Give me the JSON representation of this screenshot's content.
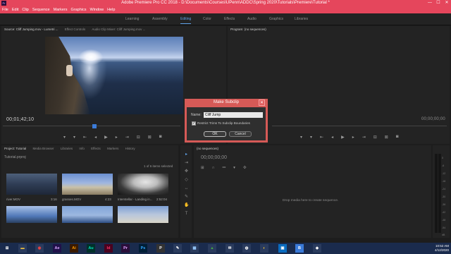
{
  "window": {
    "title": "Adobe Premiere Pro CC 2018 - D:\\Documents\\Courses\\UPenn\\ADDC\\Spring 2020\\Tutorials\\Premiere\\Tutorial *",
    "app_icon": "Pr",
    "minimize": "—",
    "maximize": "☐",
    "close": "✕"
  },
  "menu": [
    "File",
    "Edit",
    "Clip",
    "Sequence",
    "Markers",
    "Graphics",
    "Window",
    "Help"
  ],
  "workspaces": {
    "items": [
      "Learning",
      "Assembly",
      "Editing",
      "Color",
      "Effects",
      "Audio",
      "Graphics",
      "Libraries"
    ],
    "active": "Editing"
  },
  "source_panel": {
    "tabs": [
      "Source: Cliff Jumping.mov - Lumetri ...",
      "Effect Controls",
      "Audio Clip Mixer: Cliff Jumping.mov ..."
    ],
    "timecode": "00;01;42;10"
  },
  "program_panel": {
    "tabs": [
      "Program: (no sequences)"
    ],
    "timecode": "00;00;00;00"
  },
  "dialog": {
    "title": "Make Subclip",
    "close": "✕",
    "name_label": "Name:",
    "name_value": "Cliff Jump",
    "checkbox_checked": true,
    "checkbox_label": "Restrict Trims To Subclip Boundaries",
    "ok": "OK",
    "cancel": "Cancel"
  },
  "project_panel": {
    "tabs": [
      "Project: Tutorial",
      "Media Browser",
      "Libraries",
      "Info",
      "Effects",
      "Markers",
      "History"
    ],
    "path": "Tutorial.prproj",
    "item_count": "1 of 6 items selected",
    "items": [
      {
        "name": "river.MOV",
        "duration": "3:16"
      },
      {
        "name": "grasses.MOV",
        "duration": "4:23"
      },
      {
        "name": "Interstellar - Landing in...",
        "duration": "2:52:04"
      }
    ]
  },
  "timeline_panel": {
    "tabs": [
      "(no sequences)"
    ],
    "timecode": "00;00;00;00",
    "empty_message": "Drop media here to create sequence."
  },
  "meter": {
    "scale": [
      "0",
      "-6",
      "-12",
      "-18",
      "-24",
      "-30",
      "-36",
      "-42",
      "-48",
      "-54",
      "dB"
    ]
  },
  "taskbar": {
    "apps": [
      {
        "label": "⊞",
        "color": "#ffffff",
        "bg": "#1a2b4d"
      },
      {
        "label": "▬",
        "color": "#f0c040",
        "bg": "#2a3b5d"
      },
      {
        "label": "◉",
        "color": "#e44",
        "bg": "#2a3b5d"
      },
      {
        "label": "Ae",
        "color": "#d8a8ff",
        "bg": "#20114a"
      },
      {
        "label": "Ai",
        "color": "#ff9a00",
        "bg": "#3a1a00"
      },
      {
        "label": "Au",
        "color": "#00e4bb",
        "bg": "#00312a"
      },
      {
        "label": "Id",
        "color": "#ff3366",
        "bg": "#49021f"
      },
      {
        "label": "Pr",
        "color": "#e1a4ff",
        "bg": "#2a0f3a"
      },
      {
        "label": "Ps",
        "color": "#31a8ff",
        "bg": "#001e36"
      },
      {
        "label": "P",
        "color": "#ffffff",
        "bg": "#333"
      },
      {
        "label": "✎",
        "color": "#fff",
        "bg": "#2a3b5d"
      },
      {
        "label": "▦",
        "color": "#9cf",
        "bg": "#2a3b5d"
      },
      {
        "label": "▲",
        "color": "#4a4",
        "bg": "#2a3b5d"
      },
      {
        "label": "✉",
        "color": "#fff",
        "bg": "#2a3b5d"
      },
      {
        "label": "◍",
        "color": "#fff",
        "bg": "#2a3b5d"
      },
      {
        "label": "◐",
        "color": "#fc3",
        "bg": "#2a3b5d"
      },
      {
        "label": "▣",
        "color": "#fff",
        "bg": "#0a6cc0"
      },
      {
        "label": "B",
        "color": "#fff",
        "bg": "#3a7ad8"
      },
      {
        "label": "◆",
        "color": "#fff",
        "bg": "#2a3b5d"
      }
    ],
    "time": "10:52 AM",
    "date": "4/12/2020"
  }
}
